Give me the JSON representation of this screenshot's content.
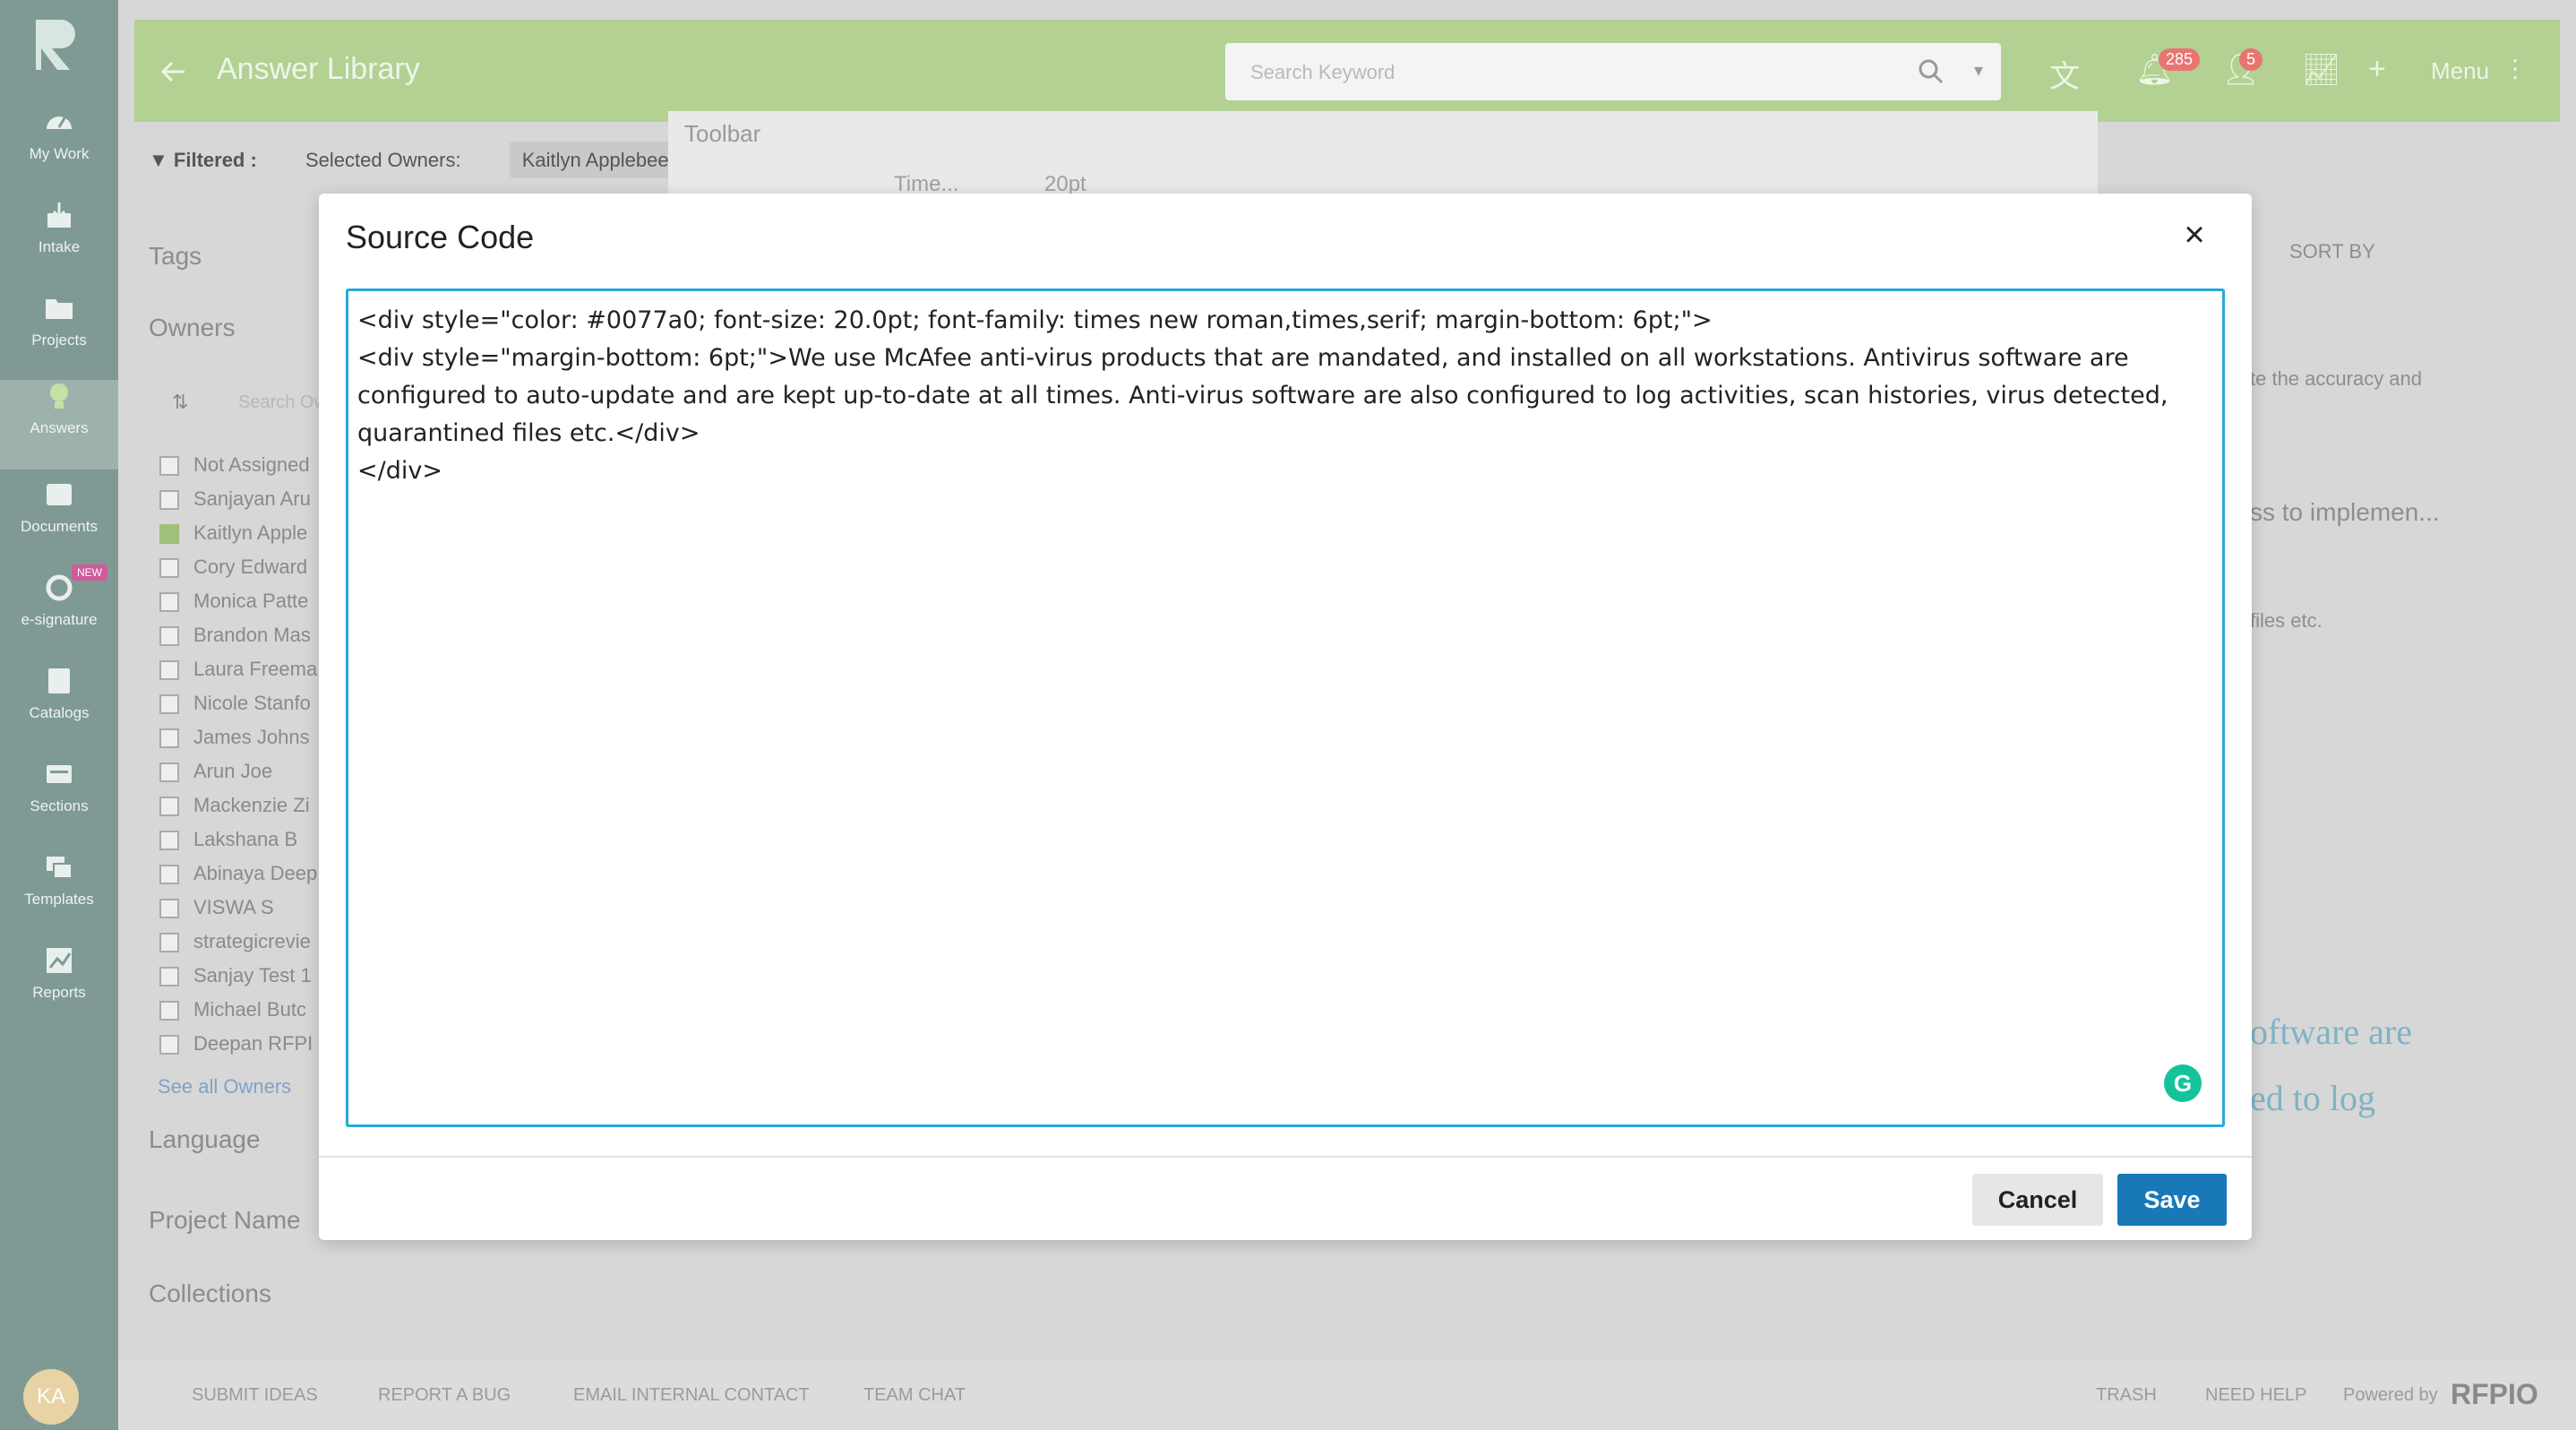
{
  "nav": {
    "items": [
      {
        "label": "My Work",
        "icon": "gauge-icon"
      },
      {
        "label": "Intake",
        "icon": "download-tray-icon"
      },
      {
        "label": "Projects",
        "icon": "folder-icon"
      },
      {
        "label": "Answers",
        "icon": "lightbulb-icon"
      },
      {
        "label": "Documents",
        "icon": "documents-icon"
      },
      {
        "label": "e-signature",
        "icon": "signature-icon",
        "badge": "NEW"
      },
      {
        "label": "Catalogs",
        "icon": "book-icon"
      },
      {
        "label": "Sections",
        "icon": "sections-icon"
      },
      {
        "label": "Templates",
        "icon": "templates-icon"
      },
      {
        "label": "Reports",
        "icon": "chart-icon"
      }
    ],
    "avatar_initials": "KA"
  },
  "header": {
    "title": "Answer Library",
    "search_placeholder": "Search Keyword",
    "notifications_count": "285",
    "users_count": "5",
    "menu_label": "Menu"
  },
  "filters": {
    "filtered_label": "Filtered :",
    "selected_owners_label": "Selected Owners:",
    "selected_owner": "Kaitlyn Applebee"
  },
  "sidepanel": {
    "tags": "Tags",
    "owners": "Owners",
    "search_placeholder": "Search Ow",
    "owner_list": [
      {
        "name": "Not Assigned",
        "checked": false
      },
      {
        "name": "Sanjayan Aru",
        "checked": false
      },
      {
        "name": "Kaitlyn Apple",
        "checked": true
      },
      {
        "name": "Cory Edward",
        "checked": false
      },
      {
        "name": "Monica Patte",
        "checked": false
      },
      {
        "name": "Brandon Mas",
        "checked": false
      },
      {
        "name": "Laura Freema",
        "checked": false
      },
      {
        "name": "Nicole Stanfo",
        "checked": false
      },
      {
        "name": "James Johns",
        "checked": false
      },
      {
        "name": "Arun Joe",
        "checked": false
      },
      {
        "name": "Mackenzie Zi",
        "checked": false
      },
      {
        "name": "Lakshana B",
        "checked": false
      },
      {
        "name": "Abinaya Deep",
        "checked": false
      },
      {
        "name": "VISWA S",
        "checked": false
      },
      {
        "name": "strategicrevie",
        "checked": false
      },
      {
        "name": "Sanjay Test 1",
        "checked": false
      },
      {
        "name": "Michael Butc",
        "checked": false
      },
      {
        "name": "Deepan RFPI",
        "checked": false
      }
    ],
    "see_all": "See all Owners",
    "language": "Language",
    "project_name": "Project Name",
    "collections": "Collections"
  },
  "toolbar": {
    "title": "Toolbar",
    "font": "Time...",
    "size": "20pt"
  },
  "right_snippets": {
    "sort_by": "SORT BY",
    "s1": "te the accuracy and",
    "s2": "ss to implemen...",
    "s3": "files etc.",
    "s4": "oftware are",
    "s5": "ed to log"
  },
  "modal": {
    "title": "Source Code",
    "code": "<div style=\"color: #0077a0; font-size: 20.0pt; font-family: times new roman,times,serif; margin-bottom: 6pt;\">\n<div style=\"margin-bottom: 6pt;\">We use McAfee anti-virus products that are mandated, and installed on all workstations. Antivirus software are configured to auto-update and are kept up-to-date at all times. Anti-virus software are also configured to log activities, scan histories, virus detected, quarantined files etc.</div>\n</div>",
    "cancel_label": "Cancel",
    "save_label": "Save",
    "grammarly_glyph": "G"
  },
  "footer": {
    "submit_ideas": "SUBMIT IDEAS",
    "report_bug": "REPORT A BUG",
    "email_contact": "EMAIL INTERNAL CONTACT",
    "team_chat": "TEAM CHAT",
    "trash": "TRASH",
    "need_help": "NEED HELP",
    "powered_by": "Powered by",
    "brand": "RFPIO"
  }
}
